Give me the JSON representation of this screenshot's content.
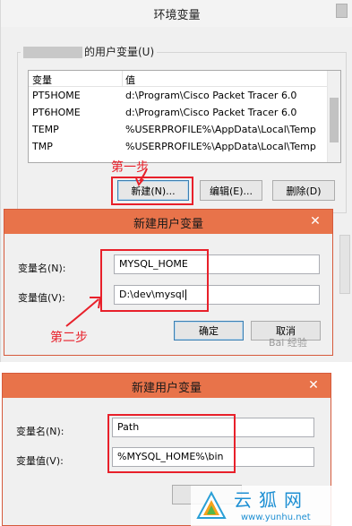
{
  "env_window": {
    "title": "环境变量",
    "user_vars_group_label": "的用户变量(U)",
    "columns": [
      "变量",
      "值"
    ],
    "rows": [
      {
        "name": "PT5HOME",
        "value": "d:\\Program\\Cisco Packet Tracer 6.0"
      },
      {
        "name": "PT6HOME",
        "value": "d:\\Program\\Cisco Packet Tracer 6.0"
      },
      {
        "name": "TEMP",
        "value": "%USERPROFILE%\\AppData\\Local\\Temp"
      },
      {
        "name": "TMP",
        "value": "%USERPROFILE%\\AppData\\Local\\Temp"
      }
    ],
    "buttons": {
      "new": "新建(N)...",
      "edit": "编辑(E)...",
      "delete": "删除(D)"
    }
  },
  "dialog1": {
    "title": "新建用户变量",
    "close_glyph": "✕",
    "name_label": "变量名(N):",
    "value_label": "变量值(V):",
    "name_value": "MYSQL_HOME",
    "value_value": "D:\\dev\\mysql",
    "ok_label": "确定",
    "cancel_label": "取消"
  },
  "dialog2": {
    "title": "新建用户变量",
    "close_glyph": "✕",
    "name_label": "变量名(N):",
    "value_label": "变量值(V):",
    "name_value": "Path",
    "value_value": "%MYSQL_HOME%\\bin"
  },
  "annotations": {
    "step1": "第一步",
    "step2": "第二步",
    "accent_color": "#e8202a"
  },
  "watermarks": {
    "baidu": "Bai 经验",
    "site": "www.yunhu.net"
  },
  "icons": [
    "close-icon",
    "arrow-step1",
    "arrow-step2",
    "yunhu-logo"
  ]
}
